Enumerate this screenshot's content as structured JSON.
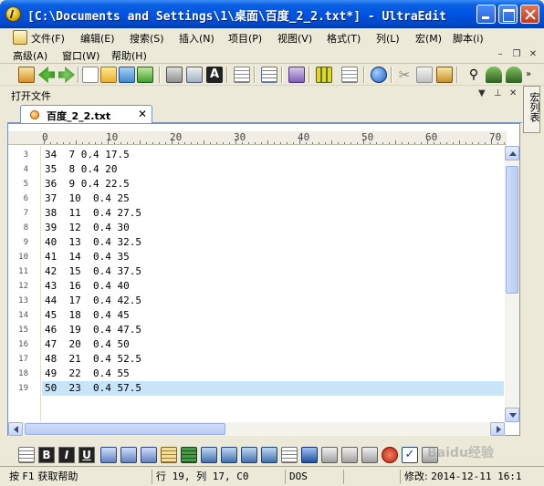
{
  "window": {
    "title": "[C:\\Documents and Settings\\1\\桌面\\百度_2_2.txt*] - UltraEdit"
  },
  "menu": {
    "row1": [
      "文件(F)",
      "编辑(E)",
      "搜索(S)",
      "插入(N)",
      "项目(P)",
      "视图(V)",
      "格式(T)",
      "列(L)",
      "宏(M)",
      "脚本(i)"
    ],
    "row2": [
      "高级(A)",
      "窗口(W)",
      "帮助(H)"
    ]
  },
  "panel": {
    "title": "打开文件",
    "controls": [
      "▼",
      "⊥",
      "✕"
    ]
  },
  "side_tab": {
    "label": "宏列表"
  },
  "tab": {
    "label": "百度_2_2.txt",
    "close": "✕"
  },
  "ruler": {
    "labels": [
      "0",
      "10",
      "20",
      "30",
      "40",
      "50",
      "60",
      "70"
    ]
  },
  "editor": {
    "lines": [
      {
        "num": "3",
        "text": "34  7 0.4 17.5"
      },
      {
        "num": "4",
        "text": "35  8 0.4 20"
      },
      {
        "num": "5",
        "text": "36  9 0.4 22.5"
      },
      {
        "num": "6",
        "text": "37  10  0.4 25"
      },
      {
        "num": "7",
        "text": "38  11  0.4 27.5"
      },
      {
        "num": "8",
        "text": "39  12  0.4 30"
      },
      {
        "num": "9",
        "text": "40  13  0.4 32.5"
      },
      {
        "num": "10",
        "text": "41  14  0.4 35"
      },
      {
        "num": "11",
        "text": "42  15  0.4 37.5"
      },
      {
        "num": "12",
        "text": "43  16  0.4 40"
      },
      {
        "num": "13",
        "text": "44  17  0.4 42.5"
      },
      {
        "num": "14",
        "text": "45  18  0.4 45"
      },
      {
        "num": "15",
        "text": "46  19  0.4 47.5"
      },
      {
        "num": "16",
        "text": "47  20  0.4 50"
      },
      {
        "num": "17",
        "text": "48  21  0.4 52.5"
      },
      {
        "num": "18",
        "text": "49  22  0.4 55"
      },
      {
        "num": "19",
        "text": "50  23  0.4 57.5"
      }
    ],
    "current_line": "19"
  },
  "format_toolbar": {
    "bold": "B",
    "italic": "I",
    "underline": "U"
  },
  "status": {
    "help": "按 F1 获取帮助",
    "position": "行 19, 列 17, C0",
    "encoding": "DOS",
    "modified_label": "修改:",
    "modified_value": "2014-12-11 16:1"
  },
  "watermark": "Baidu经验",
  "colors": {
    "titlebar": "#0054e3",
    "current_line": "#c8e4f8",
    "chrome": "#ece9d8"
  }
}
